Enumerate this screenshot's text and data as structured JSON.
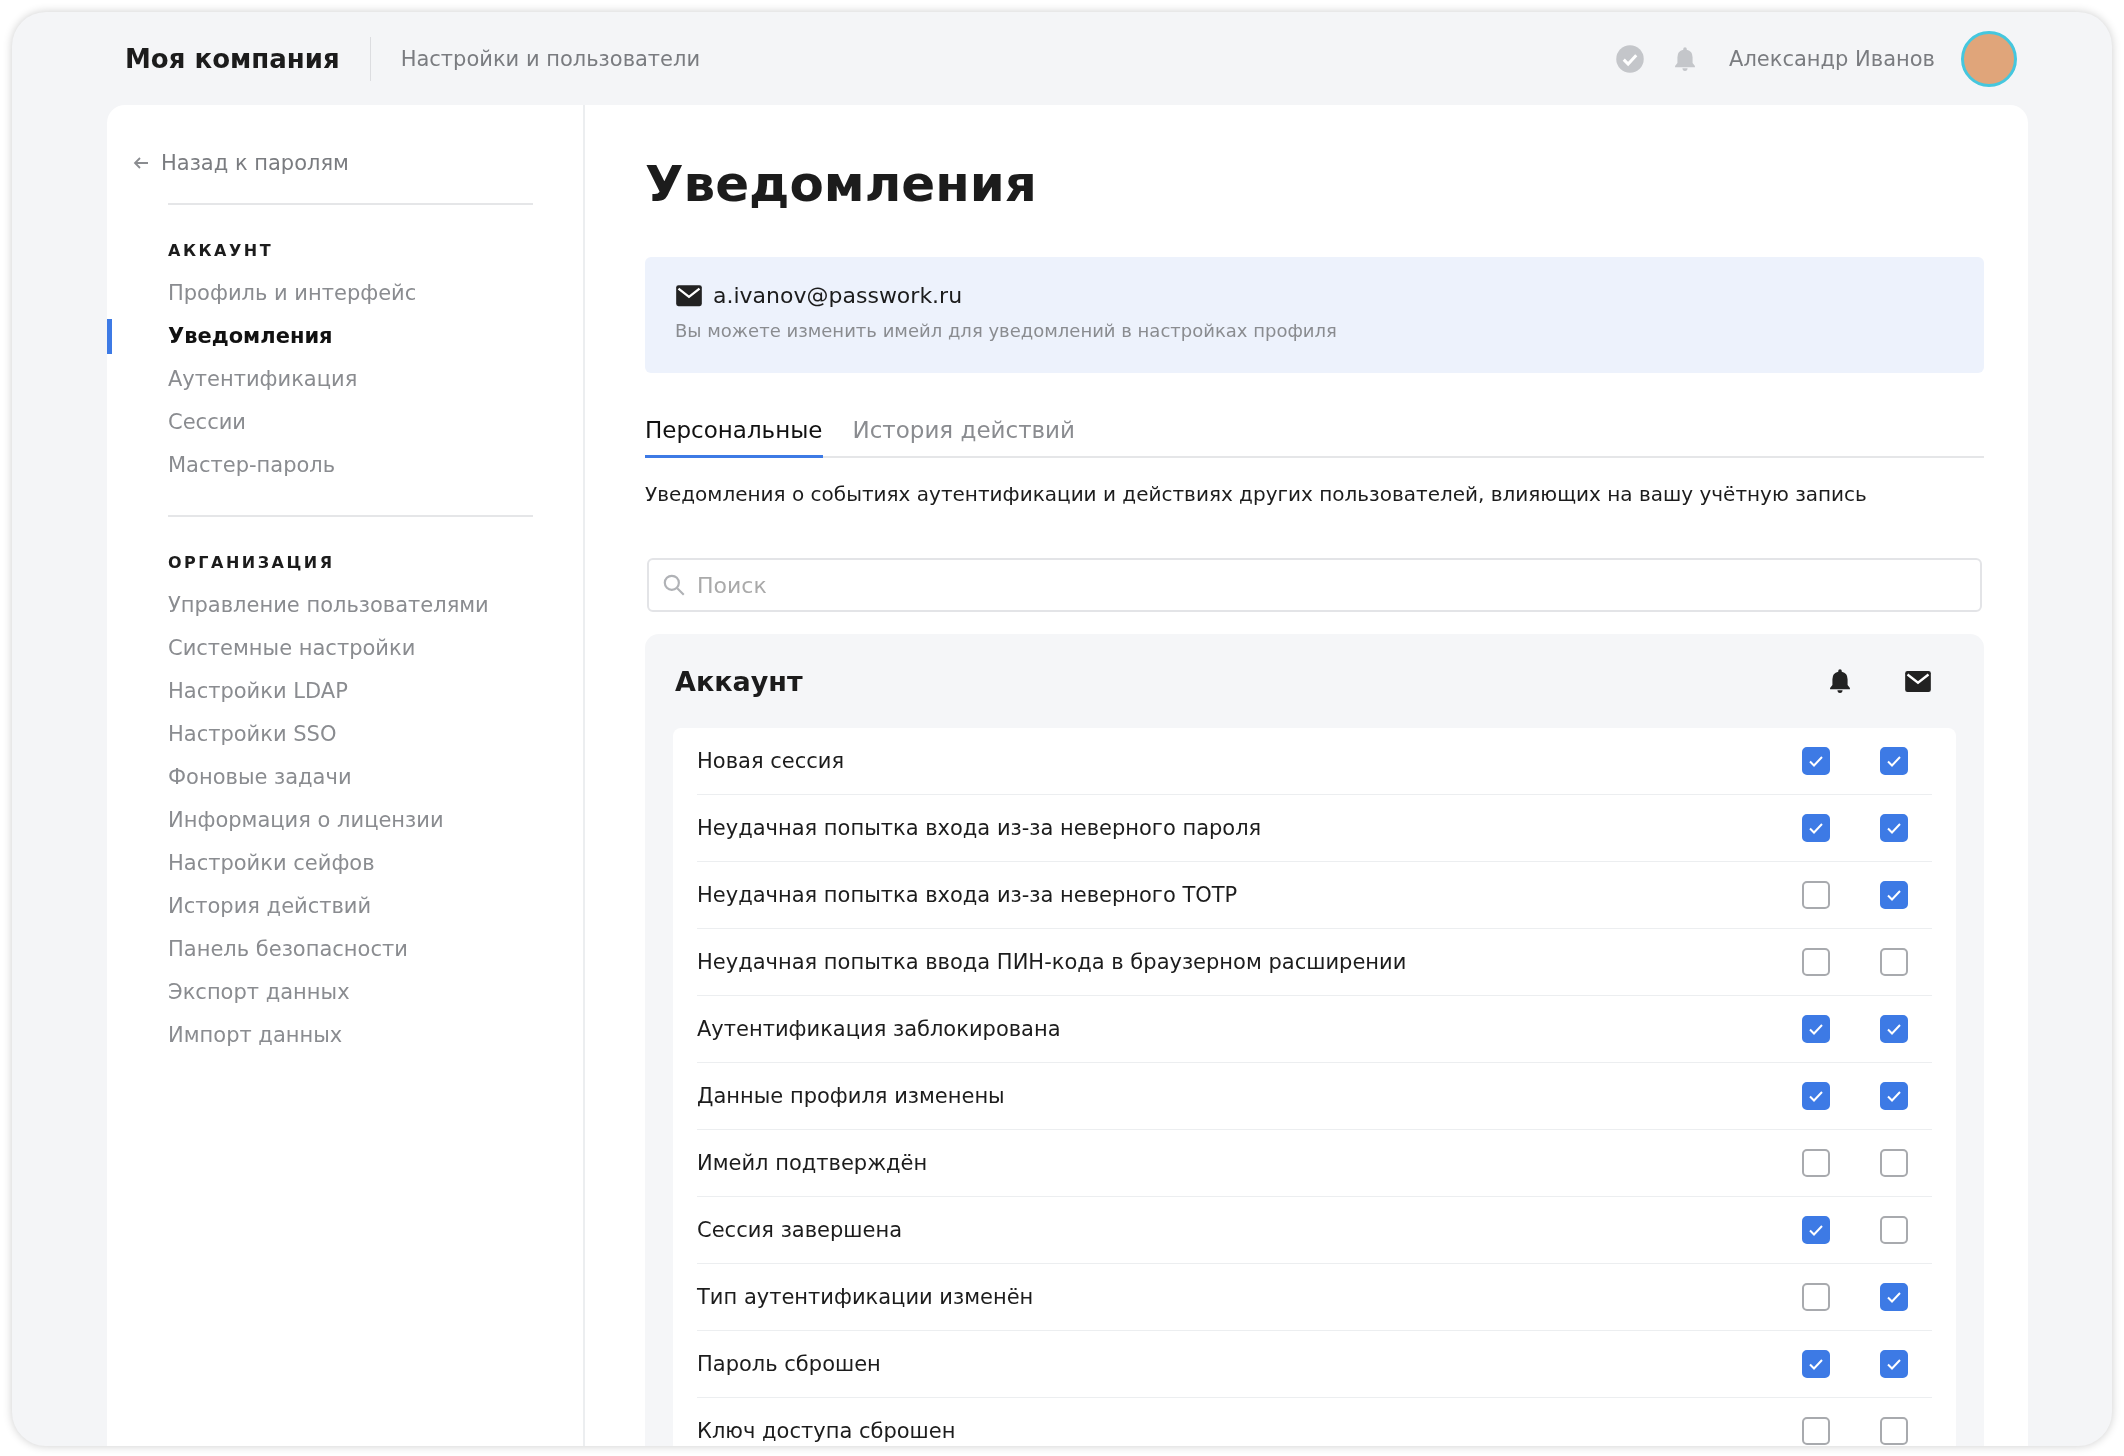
{
  "header": {
    "company": "Моя компания",
    "section": "Настройки и пользователи",
    "user_name": "Александр Иванов"
  },
  "sidebar": {
    "back_link": "Назад к паролям",
    "groups": [
      {
        "title": "АККАУНТ",
        "items": [
          {
            "label": "Профиль и интерфейс",
            "selected": false
          },
          {
            "label": "Уведомления",
            "selected": true
          },
          {
            "label": "Аутентификация",
            "selected": false
          },
          {
            "label": "Сессии",
            "selected": false
          },
          {
            "label": "Мастер-пароль",
            "selected": false
          }
        ]
      },
      {
        "title": "ОРГАНИЗАЦИЯ",
        "items": [
          {
            "label": "Управление пользователями",
            "selected": false
          },
          {
            "label": "Системные настройки",
            "selected": false
          },
          {
            "label": "Настройки LDAP",
            "selected": false
          },
          {
            "label": "Настройки SSO",
            "selected": false
          },
          {
            "label": "Фоновые задачи",
            "selected": false
          },
          {
            "label": "Информация о лицензии",
            "selected": false
          },
          {
            "label": "Настройки сейфов",
            "selected": false
          },
          {
            "label": "История действий",
            "selected": false
          },
          {
            "label": "Панель безопасности",
            "selected": false
          },
          {
            "label": "Экспорт данных",
            "selected": false
          },
          {
            "label": "Импорт данных",
            "selected": false
          }
        ]
      }
    ]
  },
  "page": {
    "title": "Уведомления",
    "email": {
      "address": "a.ivanov@passwork.ru",
      "hint": "Вы можете изменить имейл для уведомлений в настройках профиля"
    },
    "tabs": [
      {
        "label": "Персональные",
        "selected": true
      },
      {
        "label": "История действий",
        "selected": false
      }
    ],
    "description": "Уведомления о событиях аутентификации и действиях других пользователей, влияющих на вашу учётную запись",
    "search": {
      "placeholder": "Поиск"
    },
    "section": {
      "title": "Аккаунт",
      "rows": [
        {
          "label": "Новая сессия",
          "push": true,
          "email": true
        },
        {
          "label": "Неудачная попытка входа из-за неверного пароля",
          "push": true,
          "email": true
        },
        {
          "label": "Неудачная попытка входа из-за неверного TOTP",
          "push": false,
          "email": true
        },
        {
          "label": "Неудачная попытка ввода ПИН-кода в браузерном расширении",
          "push": false,
          "email": false
        },
        {
          "label": "Аутентификация заблокирована",
          "push": true,
          "email": true
        },
        {
          "label": "Данные профиля изменены",
          "push": true,
          "email": true
        },
        {
          "label": "Имейл подтверждён",
          "push": false,
          "email": false
        },
        {
          "label": "Сессия завершена",
          "push": true,
          "email": false
        },
        {
          "label": "Тип аутентификации изменён",
          "push": false,
          "email": true
        },
        {
          "label": "Пароль сброшен",
          "push": true,
          "email": true
        },
        {
          "label": "Ключ доступа сброшен",
          "push": false,
          "email": false
        }
      ]
    }
  }
}
